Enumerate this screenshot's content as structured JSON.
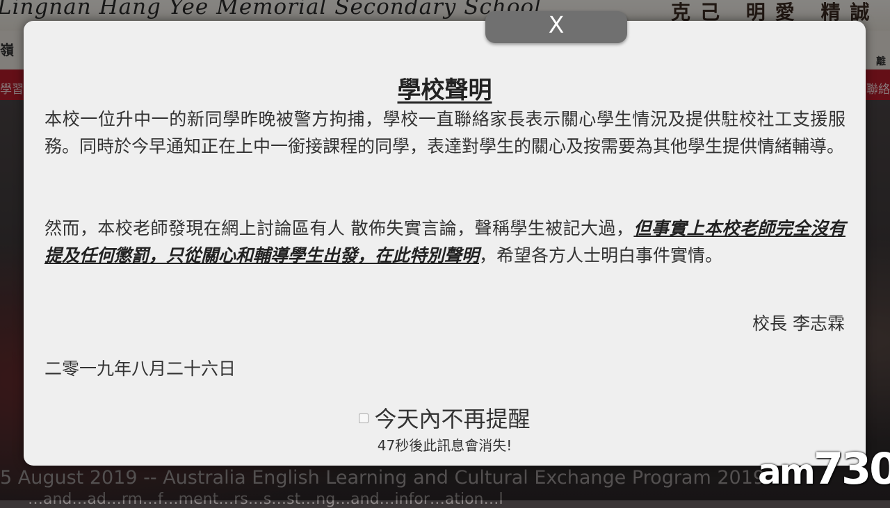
{
  "background": {
    "school_name": "Lingnan Hang Yee Memorial Secondary School",
    "motto": "克己 明愛 精誠",
    "nav_left": "嶺",
    "nav_right": "離",
    "red_left": "學習",
    "red_right": "聯絡",
    "ticker": "5 August 2019 -- Australia English Learning and Cultural Exchange Program 2019",
    "ticker_2": "…and…ad…rm…f…ment…rs…s…st…ng…and…infor…ation…l"
  },
  "watermark": {
    "am": "am",
    "num": "730"
  },
  "modal": {
    "close_label": "X",
    "title": "學校聲明",
    "para1": "本校一位升中一的新同學昨晚被警方拘捕，學校一直聯絡家長表示關心學生情況及提供駐校社工支援服務。同時於今早通知正在上中一銜接課程的同學，表達對學生的關心及按需要為其他學生提供情緒輔導。",
    "para2_a": "然而，本校老師發現在網上討論區有人 散佈失實言論，聲稱學生被記大過，",
    "para2_emph": "但事實上本校老師完全沒有提及任何懲罰，只從關心和輔導學生出發，在此特別聲明",
    "para2_b": "，希望各方人士明白事件實情。",
    "signature": "校長 李志霖",
    "date": "二零一九年八月二十六日",
    "dont_remind_label": "今天內不再提醒",
    "countdown": "47秒後此訊息會消失!"
  }
}
